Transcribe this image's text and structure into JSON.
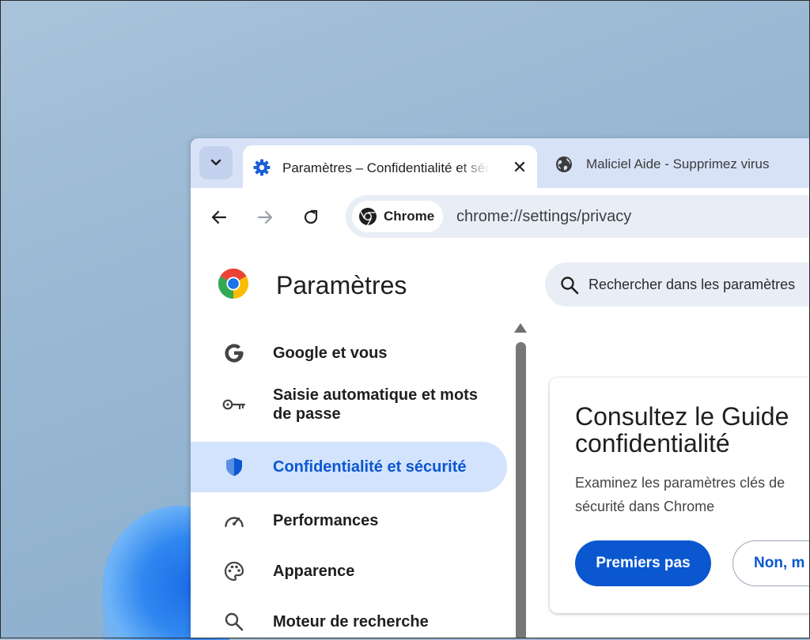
{
  "tabs": [
    {
      "title": "Paramètres – Confidentialité et sécurité",
      "active": true,
      "icon": "gear-icon",
      "close": "✕"
    },
    {
      "title": "Maliciel Aide - Supprimez virus",
      "active": false,
      "icon": "globe-icon"
    }
  ],
  "omnibox": {
    "chip_label": "Chrome",
    "url": "chrome://settings/privacy"
  },
  "settings": {
    "title": "Paramètres",
    "search_placeholder": "Rechercher dans les paramètres",
    "menu": [
      {
        "label": "Google et vous",
        "icon": "google-g-icon"
      },
      {
        "label": "Saisie automatique et mots de passe",
        "icon": "key-icon"
      },
      {
        "label": "Confidentialité et sécurité",
        "icon": "shield-icon",
        "active": true
      },
      {
        "label": "Performances",
        "icon": "speedometer-icon"
      },
      {
        "label": "Apparence",
        "icon": "palette-icon"
      },
      {
        "label": "Moteur de recherche",
        "icon": "search-icon"
      }
    ]
  },
  "guide_card": {
    "title": "Consultez le Guide\nconfidentialité",
    "description": "Examinez les paramètres clés de\nsécurité dans Chrome",
    "primary_button": "Premiers pas",
    "secondary_button": "Non, m"
  },
  "colors": {
    "accent": "#0b57d0",
    "active_bg": "#d3e3fd",
    "tabstrip": "#d7e2f7",
    "omnibox": "#e9eef6"
  }
}
